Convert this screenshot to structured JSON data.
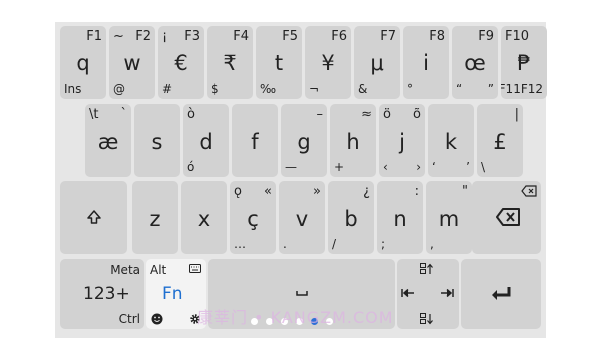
{
  "keyboard": {
    "row1": [
      {
        "main": "q",
        "tl": "",
        "tr": "F1",
        "bl": "Ins",
        "br": ""
      },
      {
        "main": "w",
        "tl": "~",
        "tr": "F2",
        "bl": "@",
        "br": ""
      },
      {
        "main": "€",
        "tl": "¡",
        "tr": "F3",
        "bl": "#",
        "br": ""
      },
      {
        "main": "₹",
        "tl": "",
        "tr": "F4",
        "bl": "$",
        "br": ""
      },
      {
        "main": "t",
        "tl": "",
        "tr": "F5",
        "bl": "‰",
        "br": ""
      },
      {
        "main": "¥",
        "tl": "",
        "tr": "F6",
        "bl": "¬",
        "br": ""
      },
      {
        "main": "μ",
        "tl": "",
        "tr": "F7",
        "bl": "&",
        "br": ""
      },
      {
        "main": "i",
        "tl": "",
        "tr": "F8",
        "bl": "°",
        "br": ""
      },
      {
        "main": "œ",
        "tl": "",
        "tr": "F9",
        "bl": "“",
        "br": "”"
      },
      {
        "main": "₱",
        "tl": "F10",
        "tr": "",
        "bl": "",
        "br": "F11F12"
      }
    ],
    "row2": [
      {
        "main": "æ",
        "tl": "\\t",
        "tr": "`",
        "bl": "",
        "br": ""
      },
      {
        "main": "s",
        "tl": "",
        "tr": "",
        "bl": "",
        "br": ""
      },
      {
        "main": "d",
        "tl": "ò",
        "tr": "",
        "bl": "ó",
        "br": ""
      },
      {
        "main": "f",
        "tl": "",
        "tr": "",
        "bl": "",
        "br": ""
      },
      {
        "main": "g",
        "tl": "",
        "tr": "–",
        "bl": "—",
        "br": ""
      },
      {
        "main": "h",
        "tl": "",
        "tr": "≈",
        "bl": "+",
        "br": ""
      },
      {
        "main": "j",
        "tl": "ö",
        "tr": "õ",
        "bl": "‹",
        "br": "›"
      },
      {
        "main": "k",
        "tl": "",
        "tr": "",
        "bl": "‘",
        "br": "’"
      },
      {
        "main": "£",
        "tl": "",
        "tr": "|",
        "bl": "\\",
        "br": ""
      }
    ],
    "row3": [
      {
        "main": "z",
        "tl": "",
        "tr": "",
        "bl": "",
        "br": ""
      },
      {
        "main": "x",
        "tl": "",
        "tr": "",
        "bl": "",
        "br": ""
      },
      {
        "main": "ç",
        "tl": "ǫ",
        "tr": "«",
        "bl": "…",
        "br": ""
      },
      {
        "main": "v",
        "tl": "",
        "tr": "»",
        "bl": ".",
        "br": ""
      },
      {
        "main": "b",
        "tl": "",
        "tr": "¿",
        "bl": "/",
        "br": ""
      },
      {
        "main": "n",
        "tl": "",
        "tr": ":",
        "bl": ";",
        "br": ""
      },
      {
        "main": "m",
        "tl": "",
        "tr": "\"",
        "bl": ",",
        "br": ""
      }
    ],
    "bottom": {
      "meta": "Meta",
      "alt": "Alt",
      "numeric": "123+",
      "ctrl": "Ctrl",
      "fn": "Fn"
    },
    "pages": {
      "count": 6,
      "active": 4
    },
    "watermark": "康莘门 • KANGZM.COM",
    "colors": {
      "accent": "#1e6fd0",
      "key": "#d2d2d2",
      "background": "#e6e6e6"
    }
  }
}
